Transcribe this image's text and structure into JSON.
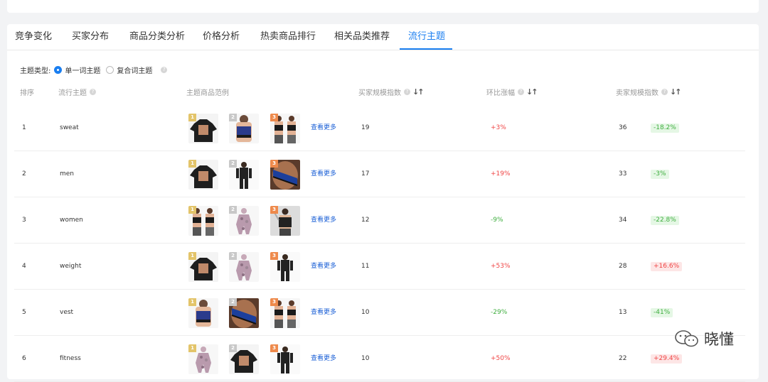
{
  "tabs": [
    {
      "label": "竞争变化"
    },
    {
      "label": "买家分布"
    },
    {
      "label": "商品分类分析"
    },
    {
      "label": "价格分析"
    },
    {
      "label": "热卖商品排行"
    },
    {
      "label": "相关品类推荐"
    },
    {
      "label": "流行主题",
      "active": true
    }
  ],
  "filter": {
    "label": "主题类型:",
    "option_single": "单一词主题",
    "option_compound": "复合词主题",
    "selected": "单一词主题"
  },
  "columns": {
    "rank": "排序",
    "theme": "流行主题",
    "examples": "主题商品范例",
    "buyer_index": "买家规模指数",
    "mom": "环比涨幅",
    "seller_index": "卖家规模指数"
  },
  "rows": [
    {
      "rank": "1",
      "theme": "sweat",
      "more": "查看更多",
      "buyer": "19",
      "mom": "+3%",
      "mom_dir": "up",
      "seller": "36",
      "seller_change": "-18.2%",
      "seller_dir": "down",
      "thumbs": [
        "sauna-shirt",
        "sports-bra",
        "two-women"
      ]
    },
    {
      "rank": "2",
      "theme": "men",
      "more": "查看更多",
      "buyer": "17",
      "mom": "+19%",
      "mom_dir": "up",
      "seller": "33",
      "seller_change": "-3%",
      "seller_dir": "down",
      "thumbs": [
        "sauna-shirt",
        "man-suit",
        "sweat-belt"
      ]
    },
    {
      "rank": "3",
      "theme": "women",
      "more": "查看更多",
      "buyer": "12",
      "mom": "-9%",
      "mom_dir": "down",
      "seller": "34",
      "seller_change": "-22.8%",
      "seller_dir": "down",
      "thumbs": [
        "two-women",
        "camo-suit",
        "woman-vest"
      ]
    },
    {
      "rank": "4",
      "theme": "weight",
      "more": "查看更多",
      "buyer": "11",
      "mom": "+53%",
      "mom_dir": "up",
      "seller": "28",
      "seller_change": "+16.6%",
      "seller_dir": "up",
      "thumbs": [
        "sauna-shirt",
        "camo-suit",
        "man-suit"
      ]
    },
    {
      "rank": "5",
      "theme": "vest",
      "more": "查看更多",
      "buyer": "10",
      "mom": "-29%",
      "mom_dir": "down",
      "seller": "13",
      "seller_change": "-41%",
      "seller_dir": "down",
      "thumbs": [
        "sports-bra",
        "sweat-belt",
        "two-women"
      ]
    },
    {
      "rank": "6",
      "theme": "fitness",
      "more": "查看更多",
      "buyer": "10",
      "mom": "+50%",
      "mom_dir": "up",
      "seller": "22",
      "seller_change": "+29.4%",
      "seller_dir": "up",
      "thumbs": [
        "camo-suit",
        "sauna-shirt",
        "man-suit"
      ]
    }
  ],
  "watermark": {
    "text": "晓懂"
  },
  "colors": {
    "accent": "#1a7ef0",
    "up": "#f04545",
    "down": "#3fae3f"
  }
}
